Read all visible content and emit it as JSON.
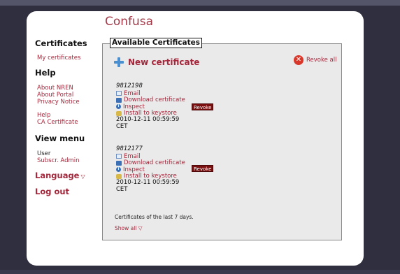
{
  "app": {
    "title": "Confusa"
  },
  "sidebar": {
    "certificates_heading": "Certificates",
    "my_certificates": "My certificates",
    "help_heading": "Help",
    "about_nren": "About NREN",
    "about_portal": "About Portal",
    "privacy_notice": "Privacy Notice",
    "help": "Help",
    "ca_certificate": "CA Certificate",
    "view_menu_heading": "View menu",
    "user": "User",
    "subscr_admin": "Subscr. Admin",
    "language": "Language",
    "log_out": "Log out"
  },
  "panel": {
    "legend": "Available Certificates",
    "new_certificate": "New certificate",
    "revoke_all": "Revoke all",
    "footer_text": "Certificates of the last 7 days.",
    "show_all": "Show all"
  },
  "certificates": [
    {
      "id": "9812198",
      "email": "Email",
      "download": "Download certificate",
      "inspect": "Inspect",
      "install": "Install to keystore",
      "date": "2010-12-11 00:59:59",
      "tz": "CET",
      "revoke": "Revoke"
    },
    {
      "id": "9812177",
      "email": "Email",
      "download": "Download certificate",
      "inspect": "Inspect",
      "install": "Install to keystore",
      "date": "2010-12-11 00:59:59",
      "tz": "CET",
      "revoke": "Revoke"
    }
  ],
  "icons": {
    "new_certificate": "plus-icon",
    "revoke_all": "revoke-x-icon",
    "email": "email-icon",
    "download": "disk-icon",
    "inspect": "info-icon",
    "install": "keystore-icon",
    "dropdown": "chevron-down-icon"
  },
  "colors": {
    "accent": "#a5273b",
    "background": "#2f2f40",
    "panel": "#eaeaea",
    "revoke_button": "#7a0f10"
  }
}
